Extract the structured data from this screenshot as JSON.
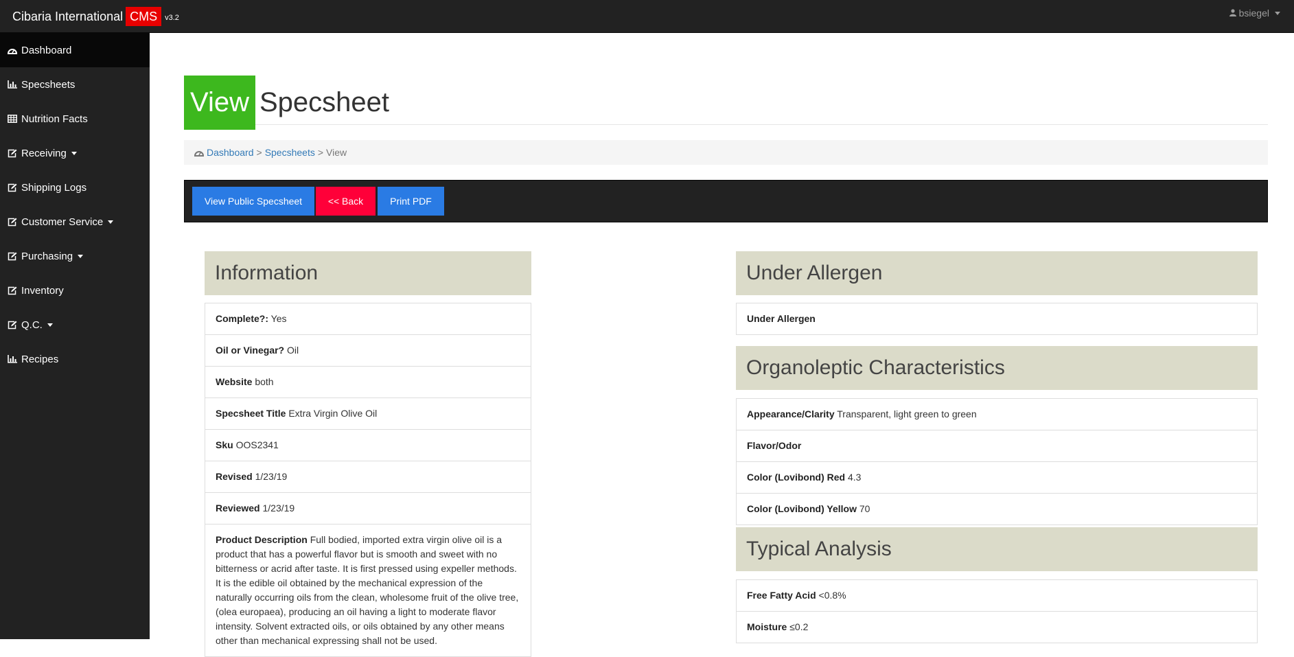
{
  "header": {
    "brand": "Cibaria International",
    "brand_badge": "CMS",
    "version": "v3.2",
    "user": "bsiegel"
  },
  "sidebar": {
    "items": [
      {
        "label": "Dashboard",
        "icon": "dashboard-icon",
        "dropdown": false,
        "active": true
      },
      {
        "label": "Specsheets",
        "icon": "bar-chart-icon",
        "dropdown": false
      },
      {
        "label": "Nutrition Facts",
        "icon": "table-icon",
        "dropdown": false
      },
      {
        "label": "Receiving",
        "icon": "edit-icon",
        "dropdown": true
      },
      {
        "label": "Shipping Logs",
        "icon": "edit-icon",
        "dropdown": false
      },
      {
        "label": "Customer Service",
        "icon": "edit-icon",
        "dropdown": true
      },
      {
        "label": "Purchasing",
        "icon": "edit-icon",
        "dropdown": true
      },
      {
        "label": "Inventory",
        "icon": "edit-icon",
        "dropdown": false
      },
      {
        "label": "Q.C.",
        "icon": "edit-icon",
        "dropdown": true
      },
      {
        "label": "Recipes",
        "icon": "bar-chart-icon",
        "dropdown": false
      }
    ]
  },
  "page": {
    "title_highlight": "View",
    "title_rest": "Specsheet"
  },
  "breadcrumb": {
    "home": "Dashboard",
    "sep1": ">",
    "section": "Specsheets",
    "sep2": ">",
    "current": "View"
  },
  "toolbar": {
    "public_label": "View Public Specsheet",
    "back_label": "<< Back",
    "print_label": "Print PDF"
  },
  "information": {
    "heading": "Information",
    "rows": [
      {
        "label": "Complete?:",
        "value": "Yes"
      },
      {
        "label": "Oil or Vinegar?",
        "value": "Oil"
      },
      {
        "label": "Website",
        "value": "both"
      },
      {
        "label": "Specsheet Title",
        "value": "Extra Virgin Olive Oil"
      },
      {
        "label": "Sku",
        "value": "OOS2341"
      },
      {
        "label": "Revised",
        "value": "1/23/19"
      },
      {
        "label": "Reviewed",
        "value": "1/23/19"
      },
      {
        "label": "Product Description",
        "value": "Full bodied, imported extra virgin olive oil is a product that has a powerful flavor but is smooth and sweet with no bitterness or acrid after taste. It is first pressed using expeller methods. It is the edible oil obtained by the mechanical expression of the naturally occurring oils from the clean, wholesome fruit of the olive tree, (olea europaea), producing an oil having a light to moderate flavor intensity. Solvent extracted oils, or oils obtained by any other means other than mechanical expressing shall not be used."
      }
    ]
  },
  "under_allergen": {
    "heading": "Under Allergen",
    "rows": [
      {
        "label": "Under Allergen",
        "value": ""
      }
    ]
  },
  "organoleptic": {
    "heading": "Organoleptic Characteristics",
    "rows": [
      {
        "label": "Appearance/Clarity",
        "value": "Transparent, light green to green"
      },
      {
        "label": "Flavor/Odor",
        "value": ""
      },
      {
        "label": "Color (Lovibond) Red",
        "value": "4.3"
      },
      {
        "label": "Color (Lovibond) Yellow",
        "value": "70"
      }
    ]
  },
  "typical_analysis": {
    "heading": "Typical Analysis",
    "rows": [
      {
        "label": "Free Fatty Acid",
        "value": "<0.8%"
      },
      {
        "label": "Moisture",
        "value": "≤0.2"
      }
    ]
  }
}
